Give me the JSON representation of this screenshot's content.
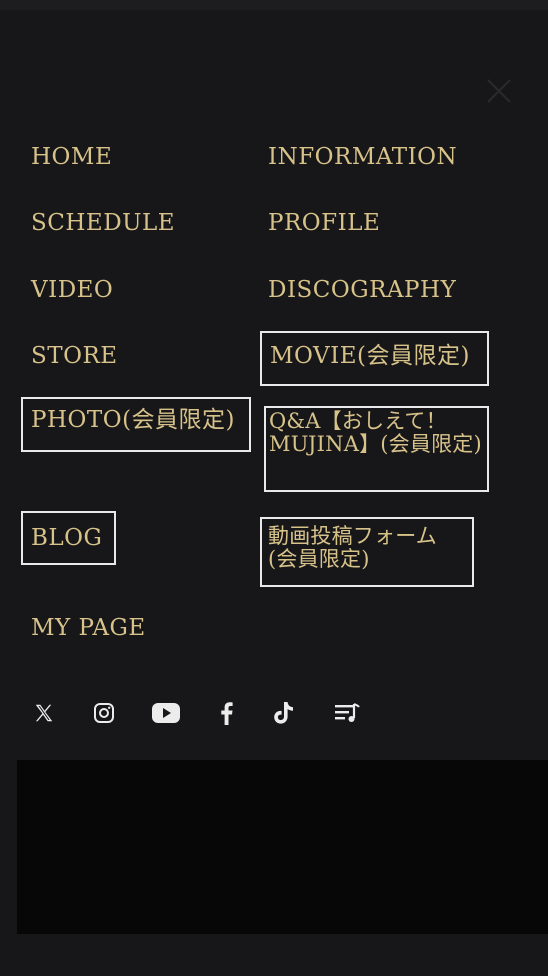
{
  "menu": {
    "close_icon": "close-icon",
    "left": [
      "HOME",
      "SCHEDULE",
      "VIDEO",
      "STORE",
      "PHOTO(会員限定)",
      "BLOG",
      "MY PAGE"
    ],
    "right": [
      "INFORMATION",
      "PROFILE",
      "DISCOGRAPHY",
      "MOVIE(会員限定)",
      "Q&A【おしえて！MUJINA】(会員限定)",
      "動画投稿フォーム(会員限定)"
    ]
  },
  "social": [
    "x-icon",
    "instagram-icon",
    "youtube-icon",
    "facebook-icon",
    "tiktok-icon",
    "playlist-icon"
  ],
  "colors": {
    "background": "#171719",
    "text": "#d7c28a",
    "highlight_border": "#e9e9e9",
    "footer": "#070707"
  }
}
